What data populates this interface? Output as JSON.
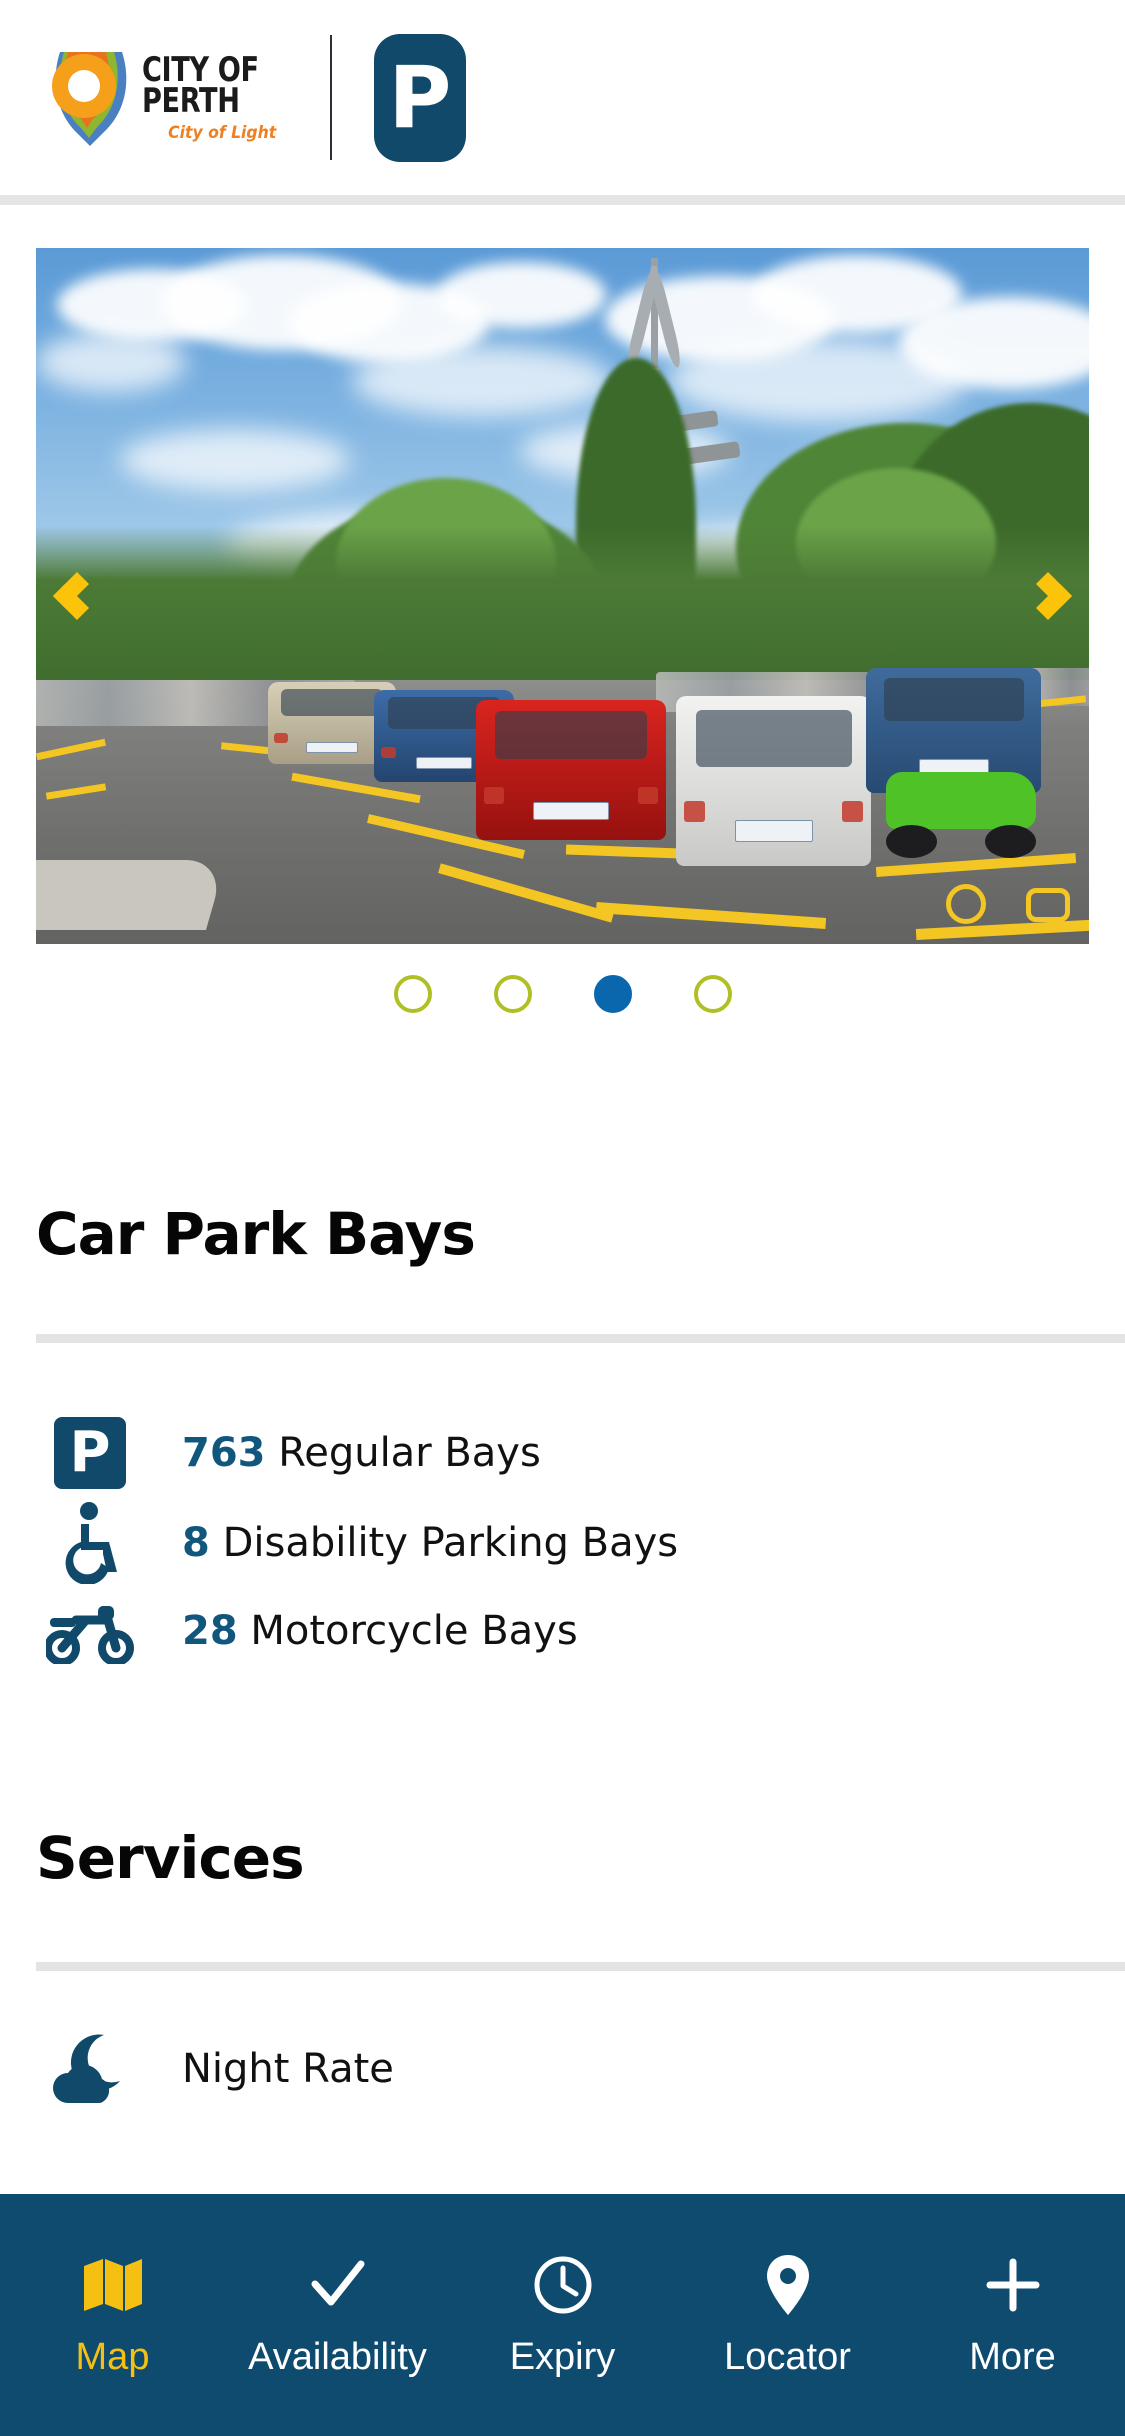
{
  "theme": {
    "brand_navy": "#0f4b6e",
    "badge_navy": "#11496b",
    "accent_yellow": "#f6c013",
    "arrow_yellow": "#fcc30b",
    "dot_olive": "#b0bf25",
    "dot_active_blue": "#0a67ad",
    "number_blue": "#11577d",
    "divider_grey": "#e3e3e3",
    "logo_orange": "#ef8022"
  },
  "header": {
    "logo": {
      "icon": "city-of-perth-swirl-logo",
      "line1": "CITY OF",
      "line2": "PERTH",
      "tagline": "City of Light"
    },
    "parking_badge": {
      "icon": "parking-p-badge",
      "letter": "P"
    }
  },
  "carousel": {
    "image_alt": "Outdoor car park with parked cars, trees and blue sky",
    "prev_label": "‹",
    "next_label": "›",
    "prev_icon": "chevron-left-icon",
    "next_icon": "chevron-right-icon",
    "slide_count": 4,
    "active_slide": 3,
    "dots": [
      {
        "index": 1,
        "active": false
      },
      {
        "index": 2,
        "active": false
      },
      {
        "index": 3,
        "active": true
      },
      {
        "index": 4,
        "active": false
      }
    ]
  },
  "bays_section": {
    "title": "Car Park Bays",
    "rows": [
      {
        "icon": "parking-p-icon",
        "count": "763",
        "label": "Regular Bays"
      },
      {
        "icon": "wheelchair-accessible-icon",
        "count": "8",
        "label": "Disability Parking Bays"
      },
      {
        "icon": "motorcycle-icon",
        "count": "28",
        "label": "Motorcycle Bays"
      }
    ]
  },
  "services_section": {
    "title": "Services",
    "rows": [
      {
        "icon": "moon-cloud-night-icon",
        "count": "",
        "label": "Night Rate"
      }
    ]
  },
  "tabbar": {
    "items": [
      {
        "icon": "map-folded-icon",
        "label": "Map",
        "active": true
      },
      {
        "icon": "check-icon",
        "label": "Availability",
        "active": false
      },
      {
        "icon": "clock-icon",
        "label": "Expiry",
        "active": false
      },
      {
        "icon": "location-pin-icon",
        "label": "Locator",
        "active": false
      },
      {
        "icon": "plus-icon",
        "label": "More",
        "active": false
      }
    ]
  }
}
